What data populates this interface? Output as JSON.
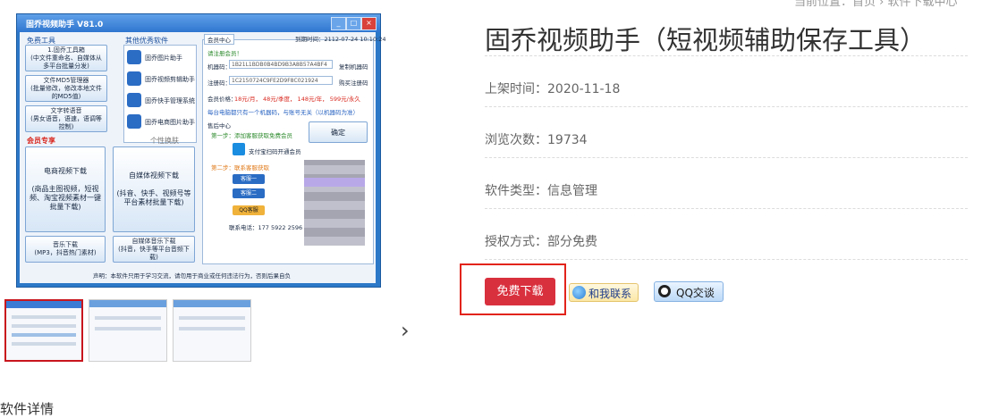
{
  "breadcrumb": "当前位置：首页 › 软件下载中心",
  "product": {
    "title": "固乔视频助手（短视频辅助保存工具）",
    "release_date": "上架时间：2020-11-18",
    "views": "浏览次数：19734",
    "category": "软件类型：信息管理",
    "license": "授权方式：部分免费"
  },
  "actions": {
    "download": "免费下载",
    "contact": "和我联系",
    "qq": "QQ交谈"
  },
  "details_heading": "软件详情",
  "thumb_next": "›",
  "preview": {
    "title": "固乔视频助手 V81.0",
    "win_buttons": [
      "_",
      "□",
      "×"
    ],
    "section_free": "免费工具",
    "section_other": "其他优秀软件",
    "section_member": "会员专享",
    "theme_toggle": "个性换肤",
    "free_tools": [
      "1.固乔工具箱\n(中文件重命名、自媒体从多平台批量分发)",
      "文件MD5管理器\n(批量修改，修改本地文件的MD5值)",
      "文字转语音\n(男女语音，语速，语调等控制)"
    ],
    "other_soft": [
      "固乔图片助手",
      "固乔视频剪辑助手",
      "固乔快手管理系统",
      "固乔电商图片助手"
    ],
    "member_big": [
      "电商视频下载\n\n(商品主图视频，短视频、淘宝视频素材一键批量下载)",
      "自媒体视频下载\n\n(抖音、快手、视频号等平台素材批量下载)"
    ],
    "member_small": [
      "音乐下载\n(MP3，抖音热门素材)",
      "自媒体音乐下载\n(抖音，快手等平台音频下载)"
    ],
    "tab_member": "会员中心",
    "expire": "到期时间：2112-07-24 10:10:24",
    "panel_title": "请注册会员！",
    "machine_label": "机器码：",
    "machine_value": "1B21L1BDB0B4BD9B3A8B57A4BF4",
    "copy_machine": "复制机器码",
    "reg_label": "注册码：",
    "reg_value": "1C2150724C9FE2D9F8C021924",
    "copy_reg": "购买注册码",
    "price_label": "会员价格：",
    "prices": "18元/月， 48元/季度， 148元/年， 599元/永久",
    "notice": "每台电脑都只有一个机器码，与账号无关（以机器码为准）",
    "vip_center": "售后中心",
    "step1": "第一步：添加客服获取免费会员",
    "alipay": "支付宝扫码开通会员",
    "step2": "第二步：联系客服获取",
    "confirm_btn": "确定",
    "kefu1": "客服一",
    "kefu2": "客服二",
    "qq_kefu": "QQ客服",
    "phone": "联系电话：177 5922 2596",
    "footer_note": "声明：本软件只用于学习交流，请勿用于商业或任何违法行为，否则后果自负"
  },
  "thumbnails": [
    {
      "active": true
    },
    {
      "active": false
    },
    {
      "active": false
    }
  ],
  "colors": {
    "download_bg": "#d9303e",
    "outline_red": "#e2231a",
    "app_blue": "#2c78c8"
  }
}
